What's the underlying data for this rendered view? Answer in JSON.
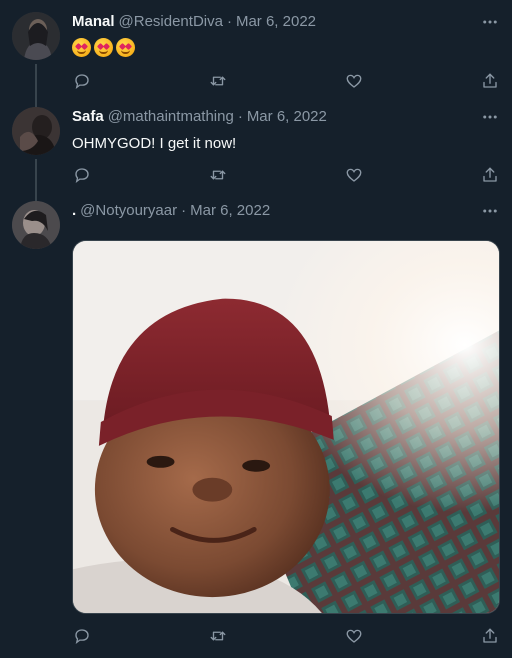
{
  "tweets": [
    {
      "name": "Manal",
      "handle": "@ResidentDiva",
      "separator": "·",
      "date": "Mar 6, 2022",
      "emoji": [
        "smiling-face-with-hearts",
        "smiling-face-with-hearts",
        "smiling-face-with-hearts"
      ],
      "emoji_alt": "🥰🥰🥰"
    },
    {
      "name": "Safa",
      "handle": "@mathaintmathing",
      "separator": "·",
      "date": "Mar 6, 2022",
      "text": "OHMYGOD! I get it now!"
    },
    {
      "name": ".",
      "handle": "@Notyouryaar",
      "separator": "·",
      "date": "Mar 6, 2022",
      "media": "photo of a smiling baby wearing a red knit beanie"
    }
  ],
  "icons": {
    "reply": "reply-icon",
    "retweet": "retweet-icon",
    "like": "like-icon",
    "share": "share-icon",
    "more": "more-icon"
  },
  "colors": {
    "background": "#15202b",
    "primary_text": "#f7f9f9",
    "secondary_text": "#8b98a5",
    "thread_line": "#38444d"
  }
}
